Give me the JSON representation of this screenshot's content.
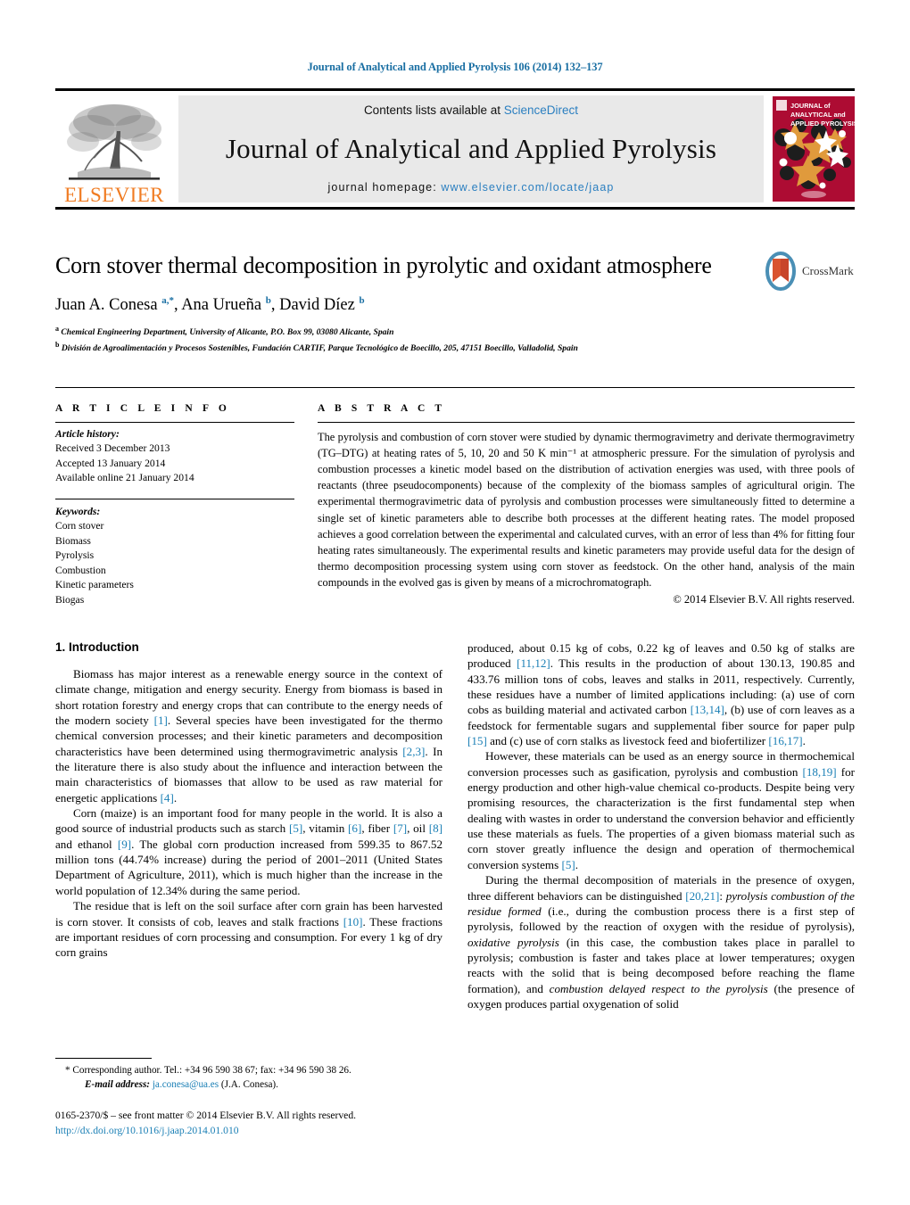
{
  "running_head": "Journal of Analytical and Applied Pyrolysis 106 (2014) 132–137",
  "masthead": {
    "publisher_name": "ELSEVIER",
    "contents_prefix": "Contents lists available at ",
    "contents_link": "ScienceDirect",
    "journal_title": "Journal of Analytical and Applied Pyrolysis",
    "homepage_label": "journal homepage: ",
    "homepage_url": "www.elsevier.com/locate/jaap",
    "cover_lines": [
      "JOURNAL of",
      "ANALYTICAL and",
      "APPLIED PYROLYSIS"
    ],
    "cover_bg": "#AD0C33",
    "cover_accent": "#E09A3C",
    "elsevier_orange": "#F07C23",
    "link_blue": "#2b7fc0"
  },
  "article": {
    "title": "Corn stover thermal decomposition in pyrolytic and oxidant atmosphere",
    "authors_html": "Juan A. Conesa <sup>a,*</sup>, Ana Urueña <sup>b</sup>, David Díez <sup>b</sup>",
    "affiliation_a": "Chemical Engineering Department, University of Alicante, P.O. Box 99, 03080 Alicante, Spain",
    "affiliation_b": "División de Agroalimentación y Procesos Sostenibles, Fundación CARTIF, Parque Tecnológico de Boecillo, 205, 47151 Boecillo, Valladolid, Spain",
    "crossmark_label": "CrossMark"
  },
  "article_info": {
    "heading": "A R T I C L E    I N F O",
    "history_label": "Article history:",
    "history": [
      "Received 3 December 2013",
      "Accepted 13 January 2014",
      "Available online 21 January 2014"
    ],
    "keywords_label": "Keywords:",
    "keywords": [
      "Corn stover",
      "Biomass",
      "Pyrolysis",
      "Combustion",
      "Kinetic parameters",
      "Biogas"
    ]
  },
  "abstract": {
    "heading": "A B S T R A C T",
    "text": "The pyrolysis and combustion of corn stover were studied by dynamic thermogravimetry and derivate thermogravimetry (TG–DTG) at heating rates of 5, 10, 20 and 50 K min⁻¹ at atmospheric pressure. For the simulation of pyrolysis and combustion processes a kinetic model based on the distribution of activation energies was used, with three pools of reactants (three pseudocomponents) because of the complexity of the biomass samples of agricultural origin. The experimental thermogravimetric data of pyrolysis and combustion processes were simultaneously fitted to determine a single set of kinetic parameters able to describe both processes at the different heating rates. The model proposed achieves a good correlation between the experimental and calculated curves, with an error of less than 4% for fitting four heating rates simultaneously. The experimental results and kinetic parameters may provide useful data for the design of thermo decomposition processing system using corn stover as feedstock. On the other hand, analysis of the main compounds in the evolved gas is given by means of a microchromatograph.",
    "copyright": "© 2014 Elsevier B.V. All rights reserved."
  },
  "body": {
    "section_heading": "1.  Introduction",
    "left_paragraphs": [
      "Biomass has major interest as a renewable energy source in the context of climate change, mitigation and energy security. Energy from biomass is based in short rotation forestry and energy crops that can contribute to the energy needs of the modern society [1]. Several species have been investigated for the thermo chemical conversion processes; and their kinetic parameters and decomposition characteristics have been determined using thermogravimetric analysis [2,3]. In the literature there is also study about the influence and interaction between the main characteristics of biomasses that allow to be used as raw material for energetic applications [4].",
      "Corn (maize) is an important food for many people in the world. It is also a good source of industrial products such as starch [5], vitamin [6], fiber [7], oil [8] and ethanol [9]. The global corn production increased from 599.35 to 867.52 million tons (44.74% increase) during the period of 2001–2011 (United States Department of Agriculture, 2011), which is much higher than the increase in the world population of 12.34% during the same period.",
      "The residue that is left on the soil surface after corn grain has been harvested is corn stover. It consists of cob, leaves and stalk fractions [10]. These fractions are important residues of corn processing and consumption. For every 1 kg of dry corn grains"
    ],
    "right_paragraphs": [
      "produced, about 0.15 kg of cobs, 0.22 kg of leaves and 0.50 kg of stalks are produced [11,12]. This results in the production of about 130.13, 190.85 and 433.76 million tons of cobs, leaves and stalks in 2011, respectively. Currently, these residues have a number of limited applications including: (a) use of corn cobs as building material and activated carbon [13,14], (b) use of corn leaves as a feedstock for fermentable sugars and supplemental fiber source for paper pulp [15] and (c) use of corn stalks as livestock feed and biofertilizer [16,17].",
      "However, these materials can be used as an energy source in thermochemical conversion processes such as gasification, pyrolysis and combustion [18,19] for energy production and other high-value chemical co-products. Despite being very promising resources, the characterization is the first fundamental step when dealing with wastes in order to understand the conversion behavior and efficiently use these materials as fuels. The properties of a given biomass material such as corn stover greatly influence the design and operation of thermochemical conversion systems [5].",
      "During the thermal decomposition of materials in the presence of oxygen, three different behaviors can be distinguished [20,21]: pyrolysis combustion of the residue formed (i.e., during the combustion process there is a first step of pyrolysis, followed by the reaction of oxygen with the residue of pyrolysis), oxidative pyrolysis (in this case, the combustion takes place in parallel to pyrolysis; combustion is faster and takes place at lower temperatures; oxygen reacts with the solid that is being decomposed before reaching the flame formation), and combustion delayed respect to the pyrolysis (the presence of oxygen produces partial oxygenation of solid"
    ]
  },
  "footnotes": {
    "corresponding": "Corresponding author. Tel.: +34 96 590 38 67; fax: +34 96 590 38 26.",
    "email_label": "E-mail address:",
    "email": "ja.conesa@ua.es",
    "email_suffix": "(J.A. Conesa).",
    "issn_line": "0165-2370/$ – see front matter © 2014 Elsevier B.V. All rights reserved.",
    "doi": "http://dx.doi.org/10.1016/j.jaap.2014.01.010"
  },
  "colors": {
    "link_blue": "#1a7fb5",
    "heading_blue": "#1a6fa3",
    "band_gray": "#e9e9e9"
  }
}
